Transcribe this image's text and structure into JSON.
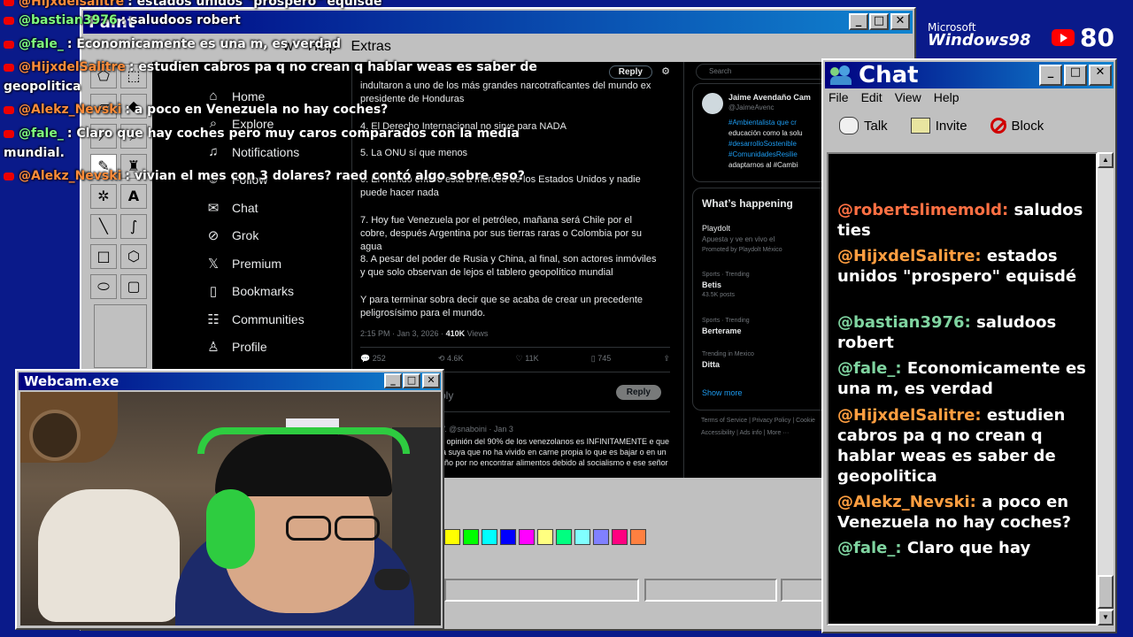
{
  "overlay_chat": [
    {
      "user": "@Hijxdelsalitre",
      "text": ": estados unidos \"prospero\" equisdé",
      "color": "#ff8c3a"
    },
    {
      "user": "@bastian3976",
      "text": ": saludoos robert",
      "color": "#7fff7f"
    },
    {
      "user": "@fale_",
      "text": ": Economicamente es una m, es verdad",
      "color": "#7fff7f"
    },
    {
      "user": "@HijxdelSalitre",
      "text": ": estudien cabros pa q no crean q hablar weas es saber de",
      "color": "#ff8c3a"
    },
    {
      "user": "",
      "text": "geopolitica",
      "color": "#ffffff"
    },
    {
      "user": "@Alekz_Nevski",
      "text": ": a poco en Venezuela no hay coches?",
      "color": "#ff8c3a"
    },
    {
      "user": "@fale_",
      "text": ": Claro que hay coches pero muy caros comparados con la media",
      "color": "#7fff7f"
    },
    {
      "user": "",
      "text": "mundial.",
      "color": "#ffffff"
    },
    {
      "user": "@Alekz_Nevski",
      "text": ": vivian el mes con 3 dolares? raed contó algo sobre eso?",
      "color": "#ff8c3a"
    }
  ],
  "paint": {
    "title": "Paint",
    "menu": [
      "Help",
      "Extras"
    ],
    "menu_partial": "w",
    "palette": [
      "#ffff00",
      "#00ff00",
      "#00ffff",
      "#0000ff",
      "#ff00ff",
      "#ffff80",
      "#00ff80",
      "#80ffff",
      "#8080ff",
      "#ff0080",
      "#ff8040"
    ]
  },
  "twitter": {
    "nav": [
      {
        "icon": "home-icon",
        "glyph": "⌂",
        "label": "Home"
      },
      {
        "icon": "explore-icon",
        "glyph": "⌕",
        "label": "Explore"
      },
      {
        "icon": "notifications-icon",
        "glyph": "♫",
        "label": "Notifications"
      },
      {
        "icon": "follow-icon",
        "glyph": "☺",
        "label": "Follow"
      },
      {
        "icon": "chat-icon",
        "glyph": "✉",
        "label": "Chat"
      },
      {
        "icon": "grok-icon",
        "glyph": "⊘",
        "label": "Grok"
      },
      {
        "icon": "premium-icon",
        "glyph": "𝕏",
        "label": "Premium"
      },
      {
        "icon": "bookmarks-icon",
        "glyph": "▯",
        "label": "Bookmarks"
      },
      {
        "icon": "communities-icon",
        "glyph": "☷",
        "label": "Communities"
      },
      {
        "icon": "profile-icon",
        "glyph": "♙",
        "label": "Profile"
      }
    ],
    "reply_label": "Reply",
    "search_placeholder": "Search",
    "paragraphs": [
      "indultaron a uno de los más grandes narcotraficantes del mundo ex presidente de Honduras",
      "4. El Derecho Internacional no sirve para NADA",
      "5. La ONU sí que menos",
      "6. El mundo entero está a merced de los Estados Unidos y nadie puede hacer nada",
      "7. Hoy fue Venezuela por el petróleo, mañana será Chile por el cobre, después Argentina por sus tierras raras o Colombia por su agua",
      "8. A pesar del poder de Rusia y China, al final, son actores inmóviles y que solo observan de lejos el tablero geopolítico mundial",
      "Y para terminar sobra decir que se acaba de crear un precedente peligrosísimo para el mundo."
    ],
    "meta": {
      "time": "2:15 PM · Jan 3, 2026 · ",
      "views": "410K",
      "views_label": " Views"
    },
    "stats": {
      "replies": "252",
      "reposts": "4.6K",
      "likes": "11K",
      "bookmarks": "745"
    },
    "reply_prompt": "ply",
    "reply_button": "Reply",
    "reply_tweet": {
      "handle": "V. @snaboini · Jan 3",
      "text": "a opinión del 90% de los venezolanos es INFINITAMENTE e que la suya que no ha vivido en carne propia lo que es bajar o en un año por no encontrar alimentos debido al socialismo e ese señor"
    },
    "suggestion": {
      "name": "Jaime Avendaño Cam",
      "handle": "@JaimeAvenc",
      "l1": "#Ambientalista que cr",
      "l2": "educación como la solu",
      "l3": "#desarrolloSostenible",
      "l4": "#ComunidadesResilie",
      "l5": "adaptarnos al #Cambi"
    },
    "happening": {
      "title": "What’s happening",
      "ad_name": "Playdolt",
      "ad_text": "Apuesta y ve en vivo el",
      "ad_promo": "Promoted by Playdolt México",
      "trends": [
        {
          "ctx": "Sports · Trending",
          "name": "Betis",
          "count": "43.5K posts"
        },
        {
          "ctx": "Sports · Trending",
          "name": "Berterame",
          "count": ""
        },
        {
          "ctx": "Trending in Mexico",
          "name": "Ditta",
          "count": ""
        }
      ],
      "show_more": "Show more",
      "footer1": "Terms of Service  |  Privacy Policy  |  Cookie",
      "footer2": "Accessibility  |  Ads info  |  More ···"
    }
  },
  "chat": {
    "title": "Chat",
    "menu": [
      "File",
      "Edit",
      "View",
      "Help"
    ],
    "toolbar": [
      {
        "icon": "talk-icon",
        "label": "Talk"
      },
      {
        "icon": "invite-icon",
        "label": "Invite"
      },
      {
        "icon": "block-icon",
        "label": "Block"
      }
    ],
    "messages": [
      {
        "user": "@robertslimemold:",
        "text": "saludos ties",
        "color": "#ff7043"
      },
      {
        "user": "@HijxdelSalitre:",
        "text": "estados unidos \"prospero\" equisdé",
        "color": "#ff9e40"
      },
      {
        "user": "@bastian3976:",
        "text": "saludoos robert",
        "color": "#7fd4a0"
      },
      {
        "user": "@fale_:",
        "text": "Economicamente es una m, es verdad",
        "color": "#7fd4a0"
      },
      {
        "user": "@HijxdelSalitre:",
        "text": "estudien cabros pa q no crean q hablar weas es saber de geopolitica",
        "color": "#ff9e40"
      },
      {
        "user": "@Alekz_Nevski:",
        "text": "a poco en Venezuela no hay coches?",
        "color": "#ff9e40"
      },
      {
        "user": "@fale_:",
        "text": "Claro que hay",
        "color": "#7fd4a0"
      }
    ]
  },
  "webcam": {
    "title": "Webcam.exe"
  },
  "branding": {
    "ms_top": "Microsoft",
    "ms_bottom": "Windows98",
    "yt_count": "80"
  }
}
